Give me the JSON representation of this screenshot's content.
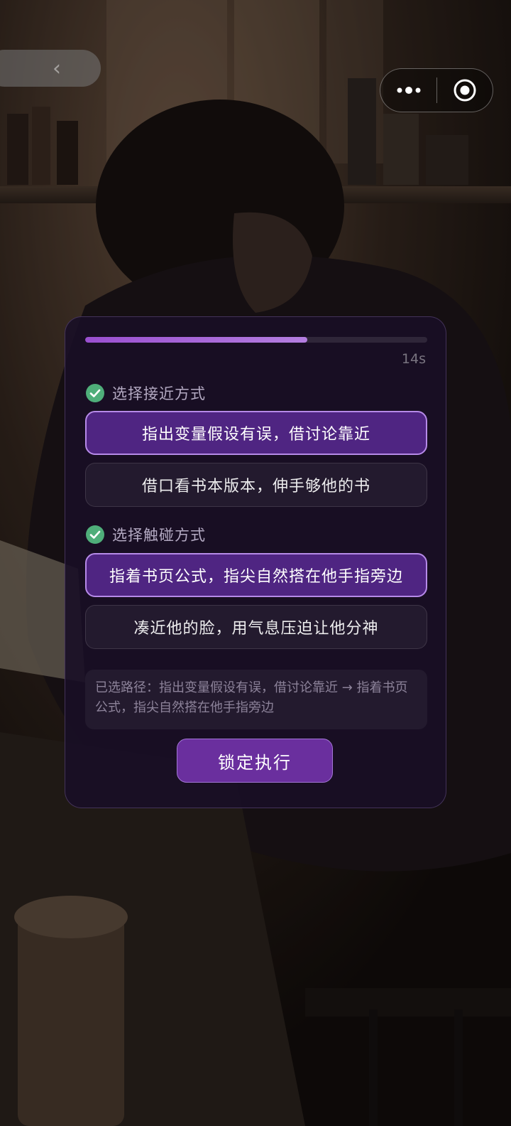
{
  "nav": {
    "back_icon": "chevron-left-icon",
    "capsule_more_icon": "more-dots-icon",
    "capsule_close_icon": "target-close-icon"
  },
  "progress": {
    "fraction": 0.65,
    "timer_text": "14s"
  },
  "steps": [
    {
      "title": "选择接近方式",
      "status": "done",
      "options": [
        {
          "label": "指出变量假设有误，借讨论靠近",
          "selected": true
        },
        {
          "label": "借口看书本版本，伸手够他的书",
          "selected": false
        }
      ]
    },
    {
      "title": "选择触碰方式",
      "status": "done",
      "options": [
        {
          "label": "指着书页公式，指尖自然搭在他手指旁边",
          "selected": true
        },
        {
          "label": "凑近他的脸，用气息压迫让他分神",
          "selected": false
        }
      ]
    }
  ],
  "path_summary": "已选路径：指出变量假设有误，借讨论靠近 → 指着书页公式，指尖自然搭在他手指旁边",
  "lock_button_label": "锁定执行",
  "colors": {
    "accent": "#9a4fd0",
    "selected_bg": "#4f2582",
    "selected_border": "#b68ae8",
    "check_green": "#4fae7a",
    "button_bg": "#6a2f9e"
  }
}
